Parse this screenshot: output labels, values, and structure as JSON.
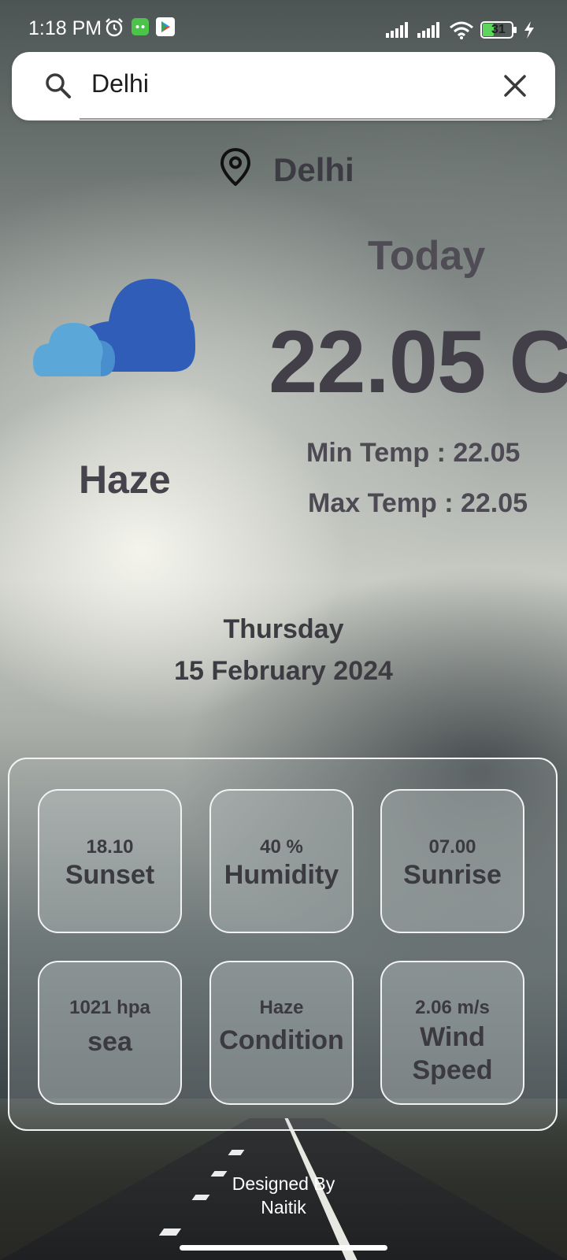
{
  "status_bar": {
    "time": "1:18 PM",
    "battery": "31"
  },
  "search": {
    "value": "Delhi"
  },
  "location": {
    "city": "Delhi"
  },
  "weather": {
    "today_label": "Today",
    "temperature": "22.05 C",
    "min_temp": "Min Temp : 22.05",
    "max_temp": "Max Temp : 22.05",
    "condition": "Haze"
  },
  "date": {
    "day": "Thursday",
    "full_date": "15 February 2024"
  },
  "details": [
    {
      "value": "18.10",
      "label": "Sunset"
    },
    {
      "value": "40 %",
      "label": "Humidity"
    },
    {
      "value": "07.00",
      "label": "Sunrise"
    },
    {
      "value": "1021 hpa",
      "label": "sea"
    },
    {
      "value": "Haze",
      "label": "Condition"
    },
    {
      "value": "2.06 m/s",
      "label": "Wind Speed"
    }
  ],
  "footer": {
    "line1": "Designed By",
    "line2": "Naitik"
  },
  "icons": {
    "weather": "cloud-icon",
    "search": "search-icon",
    "clear": "close-icon",
    "location": "location-pin-icon"
  },
  "colors": {
    "cloud_front": "#5aa7d8",
    "cloud_back": "#2f5db7",
    "text_dark": "#3d3b42"
  }
}
